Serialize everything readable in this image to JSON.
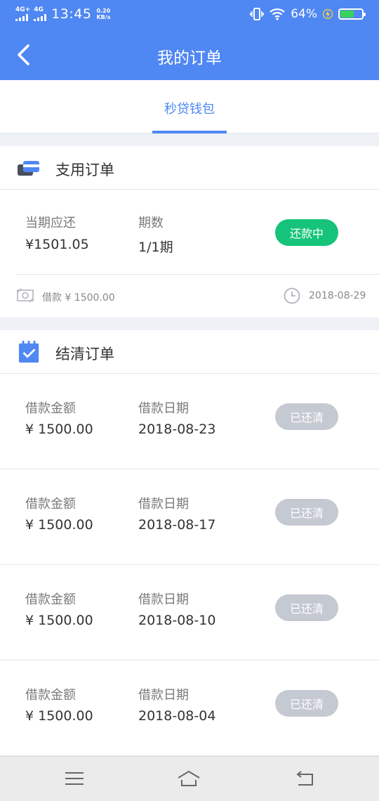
{
  "status_bar": {
    "signal1": "4G+",
    "signal2": "4G",
    "time": "13:45",
    "speed_top": "0.20",
    "speed_unit": "KB/s",
    "battery": "64%",
    "icons": [
      "vibrate-icon",
      "wifi-icon",
      "charging-icon",
      "battery-icon"
    ],
    "battery_level": 0.64
  },
  "header": {
    "title": "我的订单",
    "back_icon": "chevron-left-icon"
  },
  "tabs": [
    {
      "label": "秒贷钱包",
      "active": true
    }
  ],
  "active_order": {
    "section_title": "支用订单",
    "section_icon": "card-stack-icon",
    "due_label": "当期应还",
    "due_value": "¥1501.05",
    "period_label": "期数",
    "period_value": "1/1期",
    "status": "还款中",
    "loan_text": "借款 ¥ 1500.00",
    "loan_icon": "cash-icon",
    "date_icon": "clock-icon",
    "date": "2018-08-29"
  },
  "settled": {
    "section_title": "结清订单",
    "section_icon": "calendar-check-icon",
    "amount_label": "借款金额",
    "date_label": "借款日期",
    "status_label": "已还清",
    "orders": [
      {
        "amount": "¥ 1500.00",
        "date": "2018-08-23"
      },
      {
        "amount": "¥ 1500.00",
        "date": "2018-08-17"
      },
      {
        "amount": "¥ 1500.00",
        "date": "2018-08-10"
      },
      {
        "amount": "¥ 1500.00",
        "date": "2018-08-04"
      }
    ]
  },
  "nav_bar": {
    "icons": [
      "menu-icon",
      "home-icon",
      "back-nav-icon"
    ]
  },
  "colors": {
    "primary": "#4f87f3",
    "success": "#15c47a",
    "disabled": "#c5c9d2"
  }
}
